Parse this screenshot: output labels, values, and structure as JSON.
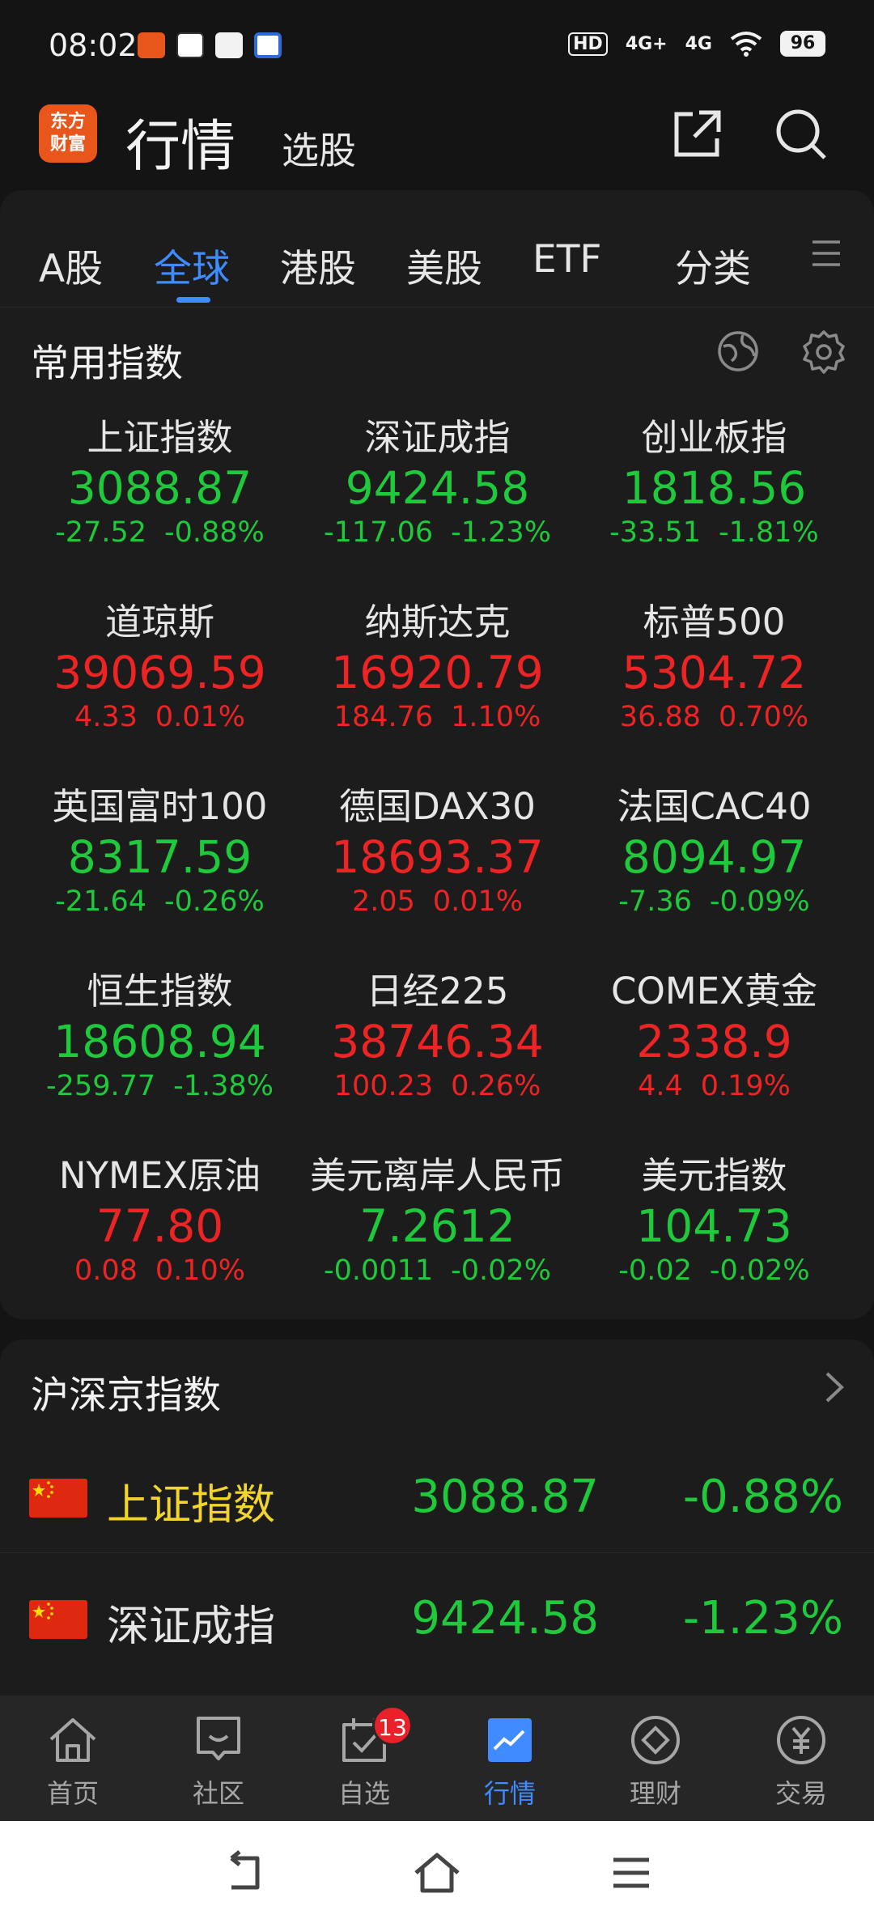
{
  "status_bar": {
    "time": "08:02",
    "network_1": "4G+",
    "network_2": "4G",
    "battery": "96"
  },
  "header": {
    "logo_text": "东方财富",
    "title": "行情",
    "subtitle": "选股"
  },
  "tabs": [
    {
      "label": "A股",
      "active": false
    },
    {
      "label": "全球",
      "active": true
    },
    {
      "label": "港股",
      "active": false
    },
    {
      "label": "美股",
      "active": false
    },
    {
      "label": "ETF",
      "active": false
    },
    {
      "label": "分类",
      "active": false
    }
  ],
  "common_indices": {
    "title": "常用指数",
    "items": [
      {
        "name": "上证指数",
        "price": "3088.87",
        "change": "-27.52",
        "percent": "-0.88%",
        "trend": "down"
      },
      {
        "name": "深证成指",
        "price": "9424.58",
        "change": "-117.06",
        "percent": "-1.23%",
        "trend": "down"
      },
      {
        "name": "创业板指",
        "price": "1818.56",
        "change": "-33.51",
        "percent": "-1.81%",
        "trend": "down"
      },
      {
        "name": "道琼斯",
        "price": "39069.59",
        "change": "4.33",
        "percent": "0.01%",
        "trend": "up"
      },
      {
        "name": "纳斯达克",
        "price": "16920.79",
        "change": "184.76",
        "percent": "1.10%",
        "trend": "up"
      },
      {
        "name": "标普500",
        "price": "5304.72",
        "change": "36.88",
        "percent": "0.70%",
        "trend": "up"
      },
      {
        "name": "英国富时100",
        "price": "8317.59",
        "change": "-21.64",
        "percent": "-0.26%",
        "trend": "down"
      },
      {
        "name": "德国DAX30",
        "price": "18693.37",
        "change": "2.05",
        "percent": "0.01%",
        "trend": "up"
      },
      {
        "name": "法国CAC40",
        "price": "8094.97",
        "change": "-7.36",
        "percent": "-0.09%",
        "trend": "down"
      },
      {
        "name": "恒生指数",
        "price": "18608.94",
        "change": "-259.77",
        "percent": "-1.38%",
        "trend": "down"
      },
      {
        "name": "日经225",
        "price": "38746.34",
        "change": "100.23",
        "percent": "0.26%",
        "trend": "up"
      },
      {
        "name": "COMEX黄金",
        "price": "2338.9",
        "change": "4.4",
        "percent": "0.19%",
        "trend": "up"
      },
      {
        "name": "NYMEX原油",
        "price": "77.80",
        "change": "0.08",
        "percent": "0.10%",
        "trend": "up"
      },
      {
        "name": "美元离岸人民币",
        "price": "7.2612",
        "change": "-0.0011",
        "percent": "-0.02%",
        "trend": "down"
      },
      {
        "name": "美元指数",
        "price": "104.73",
        "change": "-0.02",
        "percent": "-0.02%",
        "trend": "down"
      }
    ]
  },
  "hs_indices": {
    "title": "沪深京指数",
    "rows": [
      {
        "name": "上证指数",
        "price": "3088.87",
        "percent": "-0.88%",
        "highlight": true
      },
      {
        "name": "深证成指",
        "price": "9424.58",
        "percent": "-1.23%",
        "highlight": false
      }
    ]
  },
  "bottom_nav": [
    {
      "label": "首页",
      "icon": "home-icon",
      "active": false
    },
    {
      "label": "社区",
      "icon": "community-icon",
      "active": false
    },
    {
      "label": "自选",
      "icon": "watchlist-icon",
      "active": false,
      "badge": "13"
    },
    {
      "label": "行情",
      "icon": "market-icon",
      "active": true
    },
    {
      "label": "理财",
      "icon": "wealth-icon",
      "active": false
    },
    {
      "label": "交易",
      "icon": "trade-icon",
      "active": false
    }
  ],
  "colors": {
    "up": "#ee2424",
    "down": "#1fc93c",
    "accent": "#3f8bff",
    "highlight": "#f2d42a"
  }
}
